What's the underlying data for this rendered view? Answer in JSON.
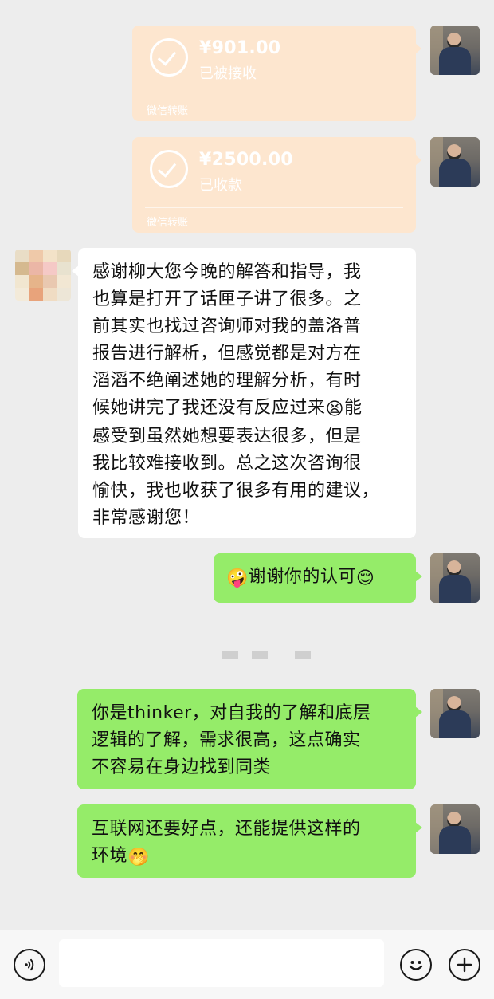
{
  "transfers": [
    {
      "amount": "¥901.00",
      "status": "已被接收",
      "source": "微信转账"
    },
    {
      "amount": "¥2500.00",
      "status": "已收款",
      "source": "微信转账"
    }
  ],
  "messages": {
    "incoming_1": {
      "lines": [
        "感谢柳大您今晚的解答和指导，我",
        "也算是打开了话匣子讲了很多。之",
        "前其实也找过咨询师对我的盖洛普",
        "报告进行解析，但感觉都是对方在",
        "滔滔不绝阐述她的理解分析，有时",
        "候她讲完了我还没有反应过来",
        "能",
        "感受到虽然她想要表达很多，但是",
        "我比较难接收到。总之这次咨询很",
        "愉快，我也收获了很多有用的建议，",
        "非常感谢您！"
      ],
      "emoji": "😫"
    },
    "outgoing_1": {
      "emoji_before": "🤪",
      "text": "谢谢你的认可",
      "emoji_after": "😌"
    },
    "outgoing_2": {
      "lines": [
        "你是thinker，对自我的了解和底层",
        "逻辑的了解，需求很高，这点确实",
        "不容易在身边找到同类"
      ]
    },
    "outgoing_3": {
      "lines": [
        "互联网还要好点，还能提供这样的",
        "环境"
      ],
      "emoji": "🤭"
    }
  },
  "colors": {
    "background": "#ededed",
    "outgoing_bubble": "#95ec69",
    "incoming_bubble": "#ffffff",
    "transfer_card": "#fde6cf"
  },
  "icons": {
    "voice": "voice-icon",
    "emoji": "emoji-icon",
    "more": "plus-icon"
  }
}
